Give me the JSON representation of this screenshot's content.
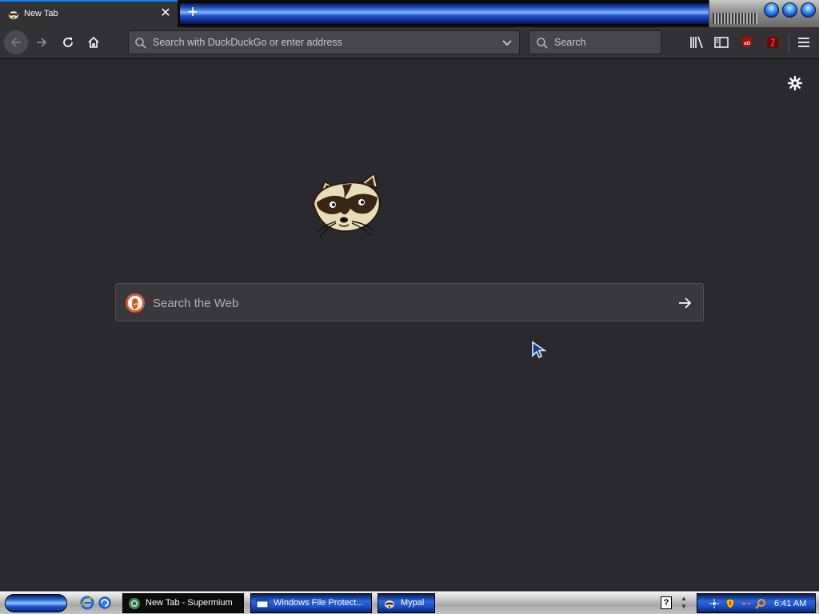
{
  "browser": {
    "tab": {
      "title": "New Tab",
      "close_glyph": "✕",
      "favicon": "raccoon-favicon-icon"
    },
    "new_tab_glyph": "+",
    "urlbar": {
      "placeholder": "Search with DuckDuckGo or enter address",
      "value": ""
    },
    "searchbox": {
      "placeholder": "Search",
      "value": ""
    },
    "toolbar_icons": [
      "back-arrow-icon",
      "forward-arrow-icon",
      "reload-icon",
      "home-icon",
      "library-icon",
      "sidebar-icon",
      "ublock-origin-icon",
      "extension-icon",
      "hamburger-menu-icon"
    ]
  },
  "newtab_page": {
    "search": {
      "placeholder": "Search the Web",
      "value": "",
      "engine_icon": "duckduckgo-icon"
    },
    "mascot": "raccoon-logo",
    "settings_icon": "gear-icon"
  },
  "taskbar": {
    "tasks": [
      {
        "label": "New Tab - Supermium",
        "icon": "supermium-icon",
        "active": true
      },
      {
        "label": "Windows File Protect...",
        "icon": "window-icon",
        "active": false
      },
      {
        "label": "Mypal",
        "icon": "mypal-icon",
        "active": false
      }
    ],
    "help_glyph": "?",
    "clock": "6:41 AM"
  },
  "colors": {
    "accent": "#0a84ff",
    "content_bg": "#2a2a2e",
    "toolbar_bg": "#323234"
  }
}
